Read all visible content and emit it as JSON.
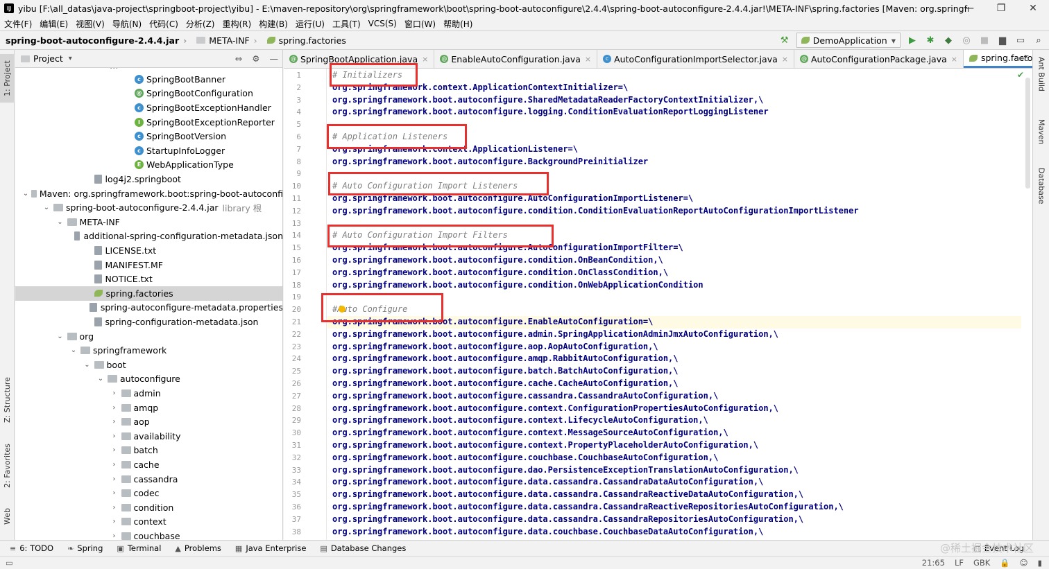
{
  "window": {
    "title": "yibu [F:\\all_datas\\java-project\\springboot-project\\yibu] - E:\\maven-repository\\org\\springframework\\boot\\spring-boot-autoconfigure\\2.4.4\\spring-boot-autoconfigure-2.4.4.jar!\\META-INF\\spring.factories [Maven: org.springframework...",
    "minimize": "—",
    "maximize": "❐",
    "close": "✕"
  },
  "menu": [
    "文件(F)",
    "编辑(E)",
    "视图(V)",
    "导航(N)",
    "代码(C)",
    "分析(Z)",
    "重构(R)",
    "构建(B)",
    "运行(U)",
    "工具(T)",
    "VCS(S)",
    "窗口(W)",
    "帮助(H)"
  ],
  "breadcrumb": {
    "jar": "spring-boot-autoconfigure-2.4.4.jar",
    "folder": "META-INF",
    "file": "spring.factories"
  },
  "toolbar": {
    "run_config": "DemoApplication"
  },
  "side_tabs": {
    "project": "1: Project",
    "structure": "Z: Structure",
    "favorites": "2: Favorites",
    "web": "Web",
    "ant": "Ant Build",
    "maven": "Maven",
    "database": "Database"
  },
  "project_panel": {
    "title": "Project",
    "rows": [
      {
        "label": "SpringBootBanner",
        "indent": 8,
        "icon": "class",
        "arrow": ""
      },
      {
        "label": "SpringBootConfiguration",
        "indent": 8,
        "icon": "annotation",
        "arrow": ""
      },
      {
        "label": "SpringBootExceptionHandler",
        "indent": 8,
        "icon": "class",
        "arrow": ""
      },
      {
        "label": "SpringBootExceptionReporter",
        "indent": 8,
        "icon": "interface",
        "arrow": ""
      },
      {
        "label": "SpringBootVersion",
        "indent": 8,
        "icon": "class",
        "arrow": ""
      },
      {
        "label": "StartupInfoLogger",
        "indent": 8,
        "icon": "class",
        "arrow": ""
      },
      {
        "label": "WebApplicationType",
        "indent": 8,
        "icon": "enum",
        "arrow": ""
      },
      {
        "label": "log4j2.springboot",
        "indent": 5,
        "icon": "file",
        "arrow": ""
      },
      {
        "label": "Maven: org.springframework.boot:spring-boot-autoconfi",
        "indent": 1,
        "icon": "lib",
        "arrow": "v"
      },
      {
        "label": "spring-boot-autoconfigure-2.4.4.jar",
        "suffix": "library 根",
        "indent": 2,
        "icon": "jar",
        "arrow": "v"
      },
      {
        "label": "META-INF",
        "indent": 3,
        "icon": "folder",
        "arrow": "v"
      },
      {
        "label": "additional-spring-configuration-metadata.json",
        "indent": 5,
        "icon": "file",
        "arrow": ""
      },
      {
        "label": "LICENSE.txt",
        "indent": 5,
        "icon": "file",
        "arrow": ""
      },
      {
        "label": "MANIFEST.MF",
        "indent": 5,
        "icon": "file",
        "arrow": ""
      },
      {
        "label": "NOTICE.txt",
        "indent": 5,
        "icon": "file",
        "arrow": ""
      },
      {
        "label": "spring.factories",
        "indent": 5,
        "icon": "leaf",
        "arrow": "",
        "selected": true
      },
      {
        "label": "spring-autoconfigure-metadata.properties",
        "indent": 5,
        "icon": "file",
        "arrow": ""
      },
      {
        "label": "spring-configuration-metadata.json",
        "indent": 5,
        "icon": "file",
        "arrow": ""
      },
      {
        "label": "org",
        "indent": 3,
        "icon": "pkg",
        "arrow": "v"
      },
      {
        "label": "springframework",
        "indent": 4,
        "icon": "pkg",
        "arrow": "v"
      },
      {
        "label": "boot",
        "indent": 5,
        "icon": "pkg",
        "arrow": "v"
      },
      {
        "label": "autoconfigure",
        "indent": 6,
        "icon": "pkg",
        "arrow": "v"
      },
      {
        "label": "admin",
        "indent": 7,
        "icon": "pkg",
        "arrow": ">"
      },
      {
        "label": "amqp",
        "indent": 7,
        "icon": "pkg",
        "arrow": ">"
      },
      {
        "label": "aop",
        "indent": 7,
        "icon": "pkg",
        "arrow": ">"
      },
      {
        "label": "availability",
        "indent": 7,
        "icon": "pkg",
        "arrow": ">"
      },
      {
        "label": "batch",
        "indent": 7,
        "icon": "pkg",
        "arrow": ">"
      },
      {
        "label": "cache",
        "indent": 7,
        "icon": "pkg",
        "arrow": ">"
      },
      {
        "label": "cassandra",
        "indent": 7,
        "icon": "pkg",
        "arrow": ">"
      },
      {
        "label": "codec",
        "indent": 7,
        "icon": "pkg",
        "arrow": ">"
      },
      {
        "label": "condition",
        "indent": 7,
        "icon": "pkg",
        "arrow": ">"
      },
      {
        "label": "context",
        "indent": 7,
        "icon": "pkg",
        "arrow": ">"
      },
      {
        "label": "couchbase",
        "indent": 7,
        "icon": "pkg",
        "arrow": ">"
      }
    ]
  },
  "tabs": [
    {
      "label": "SpringBootApplication.java",
      "icon": "annotation",
      "active": false
    },
    {
      "label": "EnableAutoConfiguration.java",
      "icon": "annotation",
      "active": false
    },
    {
      "label": "AutoConfigurationImportSelector.java",
      "icon": "class",
      "active": false
    },
    {
      "label": "AutoConfigurationPackage.java",
      "icon": "annotation",
      "active": false
    },
    {
      "label": "spring.factories",
      "icon": "leaf",
      "active": true
    }
  ],
  "tab_more": "≡5",
  "code": [
    {
      "n": "1",
      "text": "# Initializers",
      "comment": true
    },
    {
      "n": "2",
      "text": "org.springframework.context.ApplicationContextInitializer=\\"
    },
    {
      "n": "3",
      "text": "org.springframework.boot.autoconfigure.SharedMetadataReaderFactoryContextInitializer,\\"
    },
    {
      "n": "4",
      "text": "org.springframework.boot.autoconfigure.logging.ConditionEvaluationReportLoggingListener"
    },
    {
      "n": "5",
      "text": ""
    },
    {
      "n": "6",
      "text": "# Application Listeners",
      "comment": true
    },
    {
      "n": "7",
      "text": "org.springframework.context.ApplicationListener=\\"
    },
    {
      "n": "8",
      "text": "org.springframework.boot.autoconfigure.BackgroundPreinitializer"
    },
    {
      "n": "9",
      "text": ""
    },
    {
      "n": "10",
      "text": "# Auto Configuration Import Listeners",
      "comment": true
    },
    {
      "n": "11",
      "text": "org.springframework.boot.autoconfigure.AutoConfigurationImportListener=\\"
    },
    {
      "n": "12",
      "text": "org.springframework.boot.autoconfigure.condition.ConditionEvaluationReportAutoConfigurationImportListener"
    },
    {
      "n": "13",
      "text": ""
    },
    {
      "n": "14",
      "text": "# Auto Configuration Import Filters",
      "comment": true
    },
    {
      "n": "15",
      "text": "org.springframework.boot.autoconfigure.AutoConfigurationImportFilter=\\"
    },
    {
      "n": "16",
      "text": "org.springframework.boot.autoconfigure.condition.OnBeanCondition,\\"
    },
    {
      "n": "17",
      "text": "org.springframework.boot.autoconfigure.condition.OnClassCondition,\\"
    },
    {
      "n": "18",
      "text": "org.springframework.boot.autoconfigure.condition.OnWebApplicationCondition"
    },
    {
      "n": "19",
      "text": ""
    },
    {
      "n": "20",
      "text": "#Auto Configure",
      "comment": true
    },
    {
      "n": "21",
      "text": "org.springframework.boot.autoconfigure.EnableAutoConfiguration=\\",
      "current": true
    },
    {
      "n": "22",
      "text": "org.springframework.boot.autoconfigure.admin.SpringApplicationAdminJmxAutoConfiguration,\\"
    },
    {
      "n": "23",
      "text": "org.springframework.boot.autoconfigure.aop.AopAutoConfiguration,\\"
    },
    {
      "n": "24",
      "text": "org.springframework.boot.autoconfigure.amqp.RabbitAutoConfiguration,\\"
    },
    {
      "n": "25",
      "text": "org.springframework.boot.autoconfigure.batch.BatchAutoConfiguration,\\"
    },
    {
      "n": "26",
      "text": "org.springframework.boot.autoconfigure.cache.CacheAutoConfiguration,\\"
    },
    {
      "n": "27",
      "text": "org.springframework.boot.autoconfigure.cassandra.CassandraAutoConfiguration,\\"
    },
    {
      "n": "28",
      "text": "org.springframework.boot.autoconfigure.context.ConfigurationPropertiesAutoConfiguration,\\"
    },
    {
      "n": "29",
      "text": "org.springframework.boot.autoconfigure.context.LifecycleAutoConfiguration,\\"
    },
    {
      "n": "30",
      "text": "org.springframework.boot.autoconfigure.context.MessageSourceAutoConfiguration,\\"
    },
    {
      "n": "31",
      "text": "org.springframework.boot.autoconfigure.context.PropertyPlaceholderAutoConfiguration,\\"
    },
    {
      "n": "32",
      "text": "org.springframework.boot.autoconfigure.couchbase.CouchbaseAutoConfiguration,\\"
    },
    {
      "n": "33",
      "text": "org.springframework.boot.autoconfigure.dao.PersistenceExceptionTranslationAutoConfiguration,\\"
    },
    {
      "n": "34",
      "text": "org.springframework.boot.autoconfigure.data.cassandra.CassandraDataAutoConfiguration,\\"
    },
    {
      "n": "35",
      "text": "org.springframework.boot.autoconfigure.data.cassandra.CassandraReactiveDataAutoConfiguration,\\"
    },
    {
      "n": "36",
      "text": "org.springframework.boot.autoconfigure.data.cassandra.CassandraReactiveRepositoriesAutoConfiguration,\\"
    },
    {
      "n": "37",
      "text": "org.springframework.boot.autoconfigure.data.cassandra.CassandraRepositoriesAutoConfiguration,\\"
    },
    {
      "n": "38",
      "text": "org.springframework.boot.autoconfigure.data.couchbase.CouchbaseDataAutoConfiguration,\\"
    }
  ],
  "bottom_tools": [
    {
      "label": "6: TODO",
      "icon": "≡"
    },
    {
      "label": "Spring",
      "icon": "❧"
    },
    {
      "label": "Terminal",
      "icon": "▣"
    },
    {
      "label": "Problems",
      "icon": "▲"
    },
    {
      "label": "Java Enterprise",
      "icon": "▦"
    },
    {
      "label": "Database Changes",
      "icon": "▤"
    }
  ],
  "event_log": "Event Log",
  "watermark": "@稀土掘金技术社区",
  "status": {
    "position": "21:65",
    "line_sep": "LF",
    "encoding": "GBK"
  },
  "colors": {
    "highlight_box": "#e8302f",
    "keyword_blue": "#000080",
    "comment_gray": "#808080",
    "accent": "#4083c9"
  }
}
